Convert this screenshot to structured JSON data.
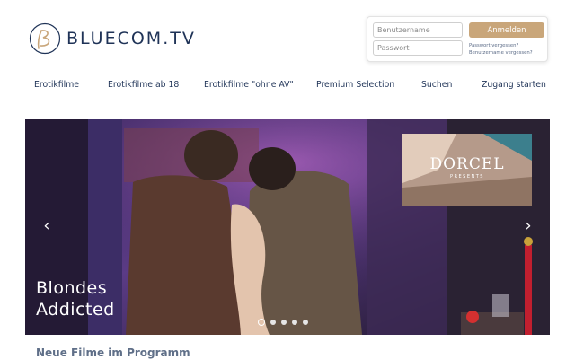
{
  "header": {
    "logo_text": "BLUECOM.TV",
    "logo_icon": "script-b-logo-icon"
  },
  "login": {
    "username_placeholder": "Benutzername",
    "password_placeholder": "Passwort",
    "submit_label": "Anmelden",
    "forgot_password": "Passwort vergessen?",
    "forgot_username": "Benutzername vergessen?"
  },
  "nav": {
    "items": [
      {
        "label": "Erotikfilme"
      },
      {
        "label": "Erotikfilme ab 18"
      },
      {
        "label": "Erotikfilme \"ohne AV\""
      },
      {
        "label": "Premium Selection"
      },
      {
        "label": "Suchen"
      },
      {
        "label": "Zugang starten"
      }
    ]
  },
  "slider": {
    "title_line1": "Blondes",
    "title_line2": "Addicted",
    "prev_icon": "chevron-left-icon",
    "next_icon": "chevron-right-icon",
    "slide_count": 5,
    "active_slide": 1,
    "badge": {
      "brand": "DORCEL",
      "subtitle": "PRESENTS"
    }
  },
  "section": {
    "heading": "Neue Filme im Programm"
  }
}
